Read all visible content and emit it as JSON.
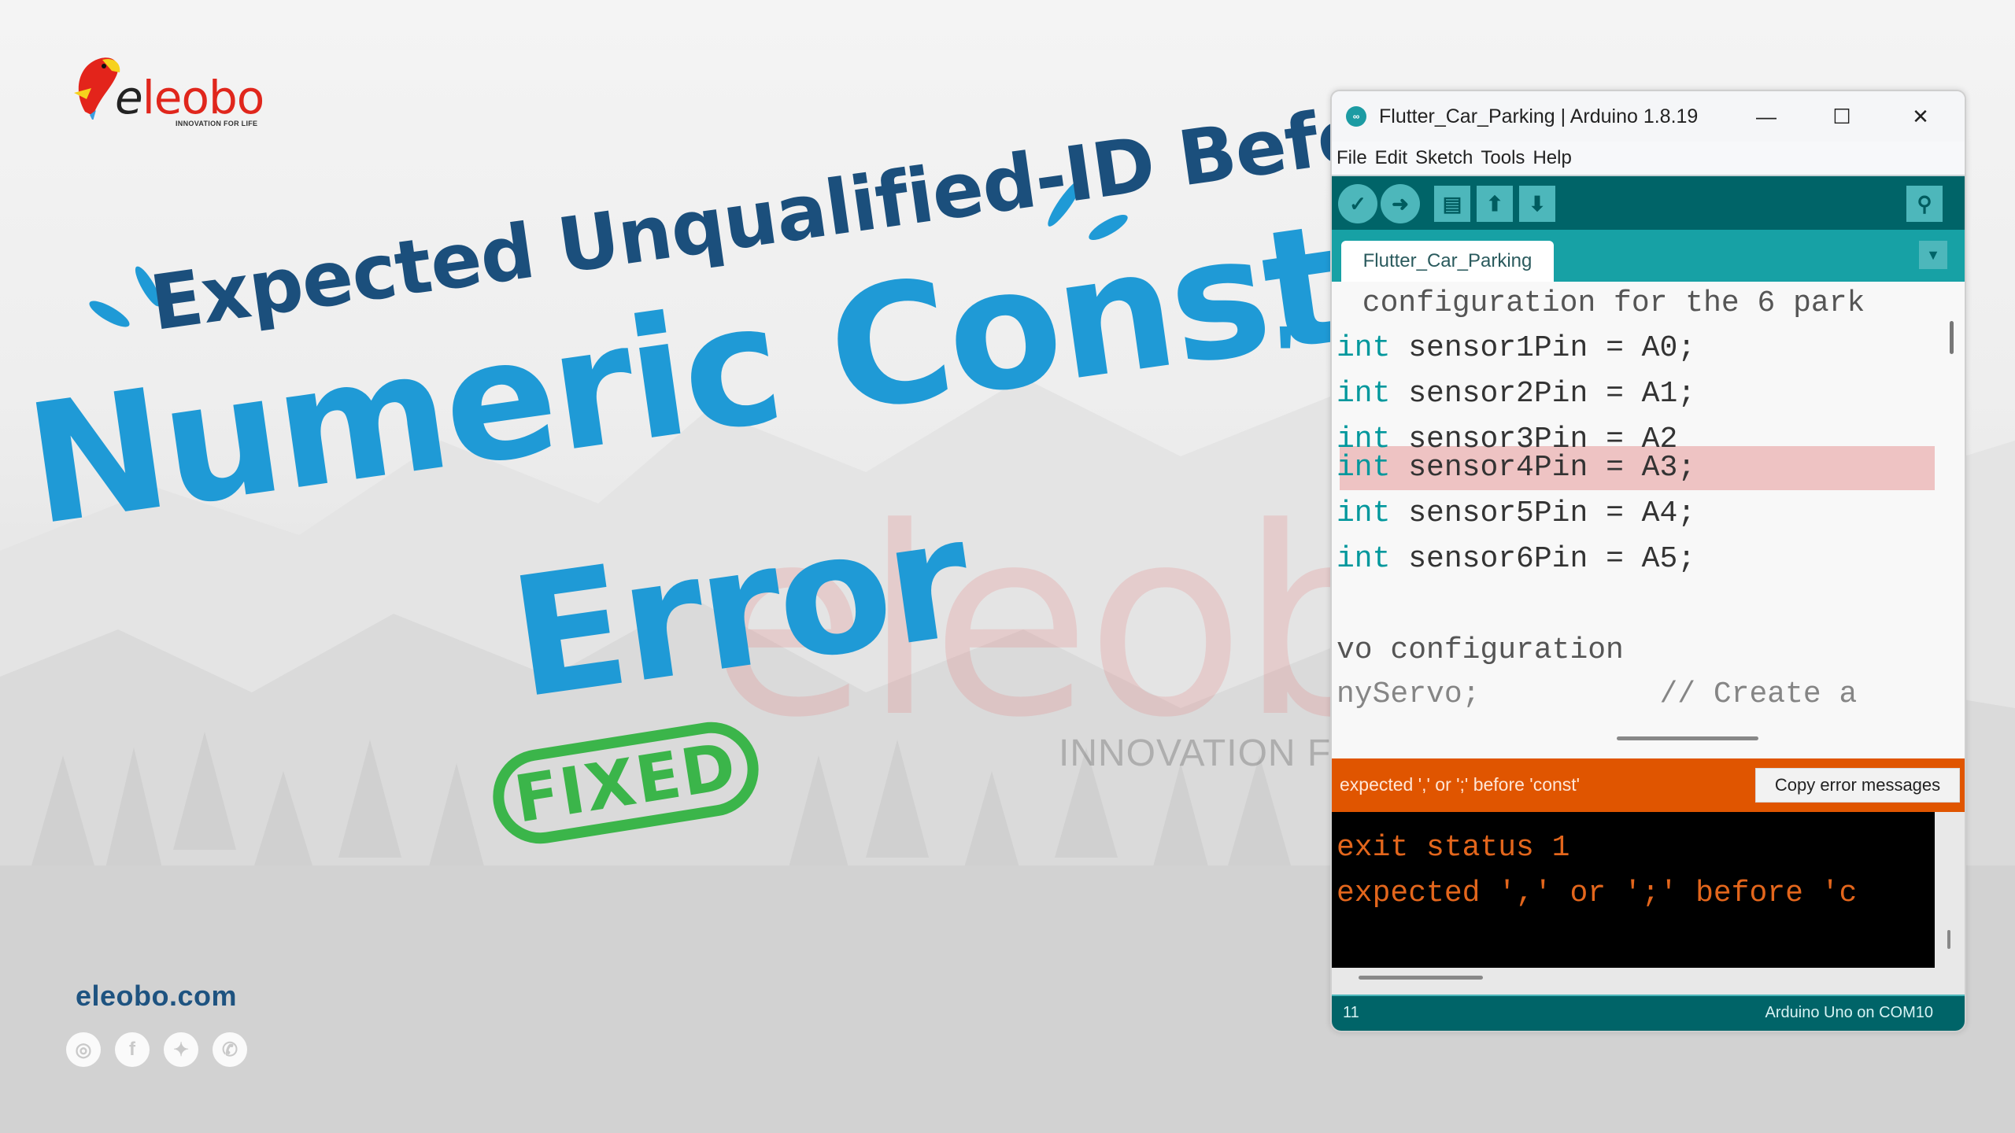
{
  "brand": {
    "logo_word_prefix": "e",
    "logo_word_rest": "leobo",
    "tagline": "INNOVATION FOR LIFE",
    "website": "eleobo.com",
    "watermark_word": "eleobo",
    "watermark_tagline": "INNOVATION FOR LIFE",
    "socials": [
      {
        "name": "instagram",
        "glyph": "◎"
      },
      {
        "name": "facebook",
        "glyph": "f"
      },
      {
        "name": "twitter",
        "glyph": "✦"
      },
      {
        "name": "whatsapp",
        "glyph": "✆"
      }
    ]
  },
  "headline": {
    "line1": "Expected Unqualified-ID Before",
    "line2": "Numeric Constant",
    "quote": "'",
    "line3": "Error",
    "stamp": "FIXED"
  },
  "colors": {
    "headline_dark": "#1b4f7c",
    "headline_blue": "#1f9ad6",
    "stamp_green": "#3bb54a",
    "arduino_teal": "#006468",
    "arduino_tab_teal": "#17a1a5",
    "error_orange": "#e05500"
  },
  "window": {
    "title": "Flutter_Car_Parking | Arduino 1.8.19",
    "controls": {
      "minimize": "—",
      "maximize": "☐",
      "close": "✕"
    },
    "menu": [
      "File",
      "Edit",
      "Sketch",
      "Tools",
      "Help"
    ],
    "toolbar": {
      "verify": "✓",
      "upload": "➜",
      "new": "▤",
      "open": "⬆",
      "save": "⬇",
      "serial_monitor": "⚲"
    },
    "tab": {
      "label": "Flutter_Car_Parking",
      "menu_glyph": "▼"
    },
    "code": [
      {
        "kw": "",
        "text": " configuration for the 6 park",
        "comment": true
      },
      {
        "kw": "int",
        "text": " sensor1Pin = A0;"
      },
      {
        "kw": "int",
        "text": " sensor2Pin = A1;"
      },
      {
        "kw": "int",
        "text": " sensor3Pin = A2"
      },
      {
        "kw": "int",
        "text": " sensor4Pin = A3;"
      },
      {
        "kw": "int",
        "text": " sensor5Pin = A4;"
      },
      {
        "kw": "int",
        "text": " sensor6Pin = A5;"
      },
      {
        "kw": "",
        "text": ""
      },
      {
        "kw": "",
        "text": "vo configuration",
        "comment": true
      },
      {
        "kw": "",
        "text": "nyServo;          // Create a",
        "comment": true
      }
    ],
    "highlighted_line_index": 4,
    "error_bar": {
      "message": "expected ',' or ';' before 'const'",
      "copy_button": "Copy error messages"
    },
    "console": [
      "exit status 1",
      "expected ',' or ';' before 'c"
    ],
    "status": {
      "line": "11",
      "board": "Arduino Uno on COM10"
    }
  }
}
